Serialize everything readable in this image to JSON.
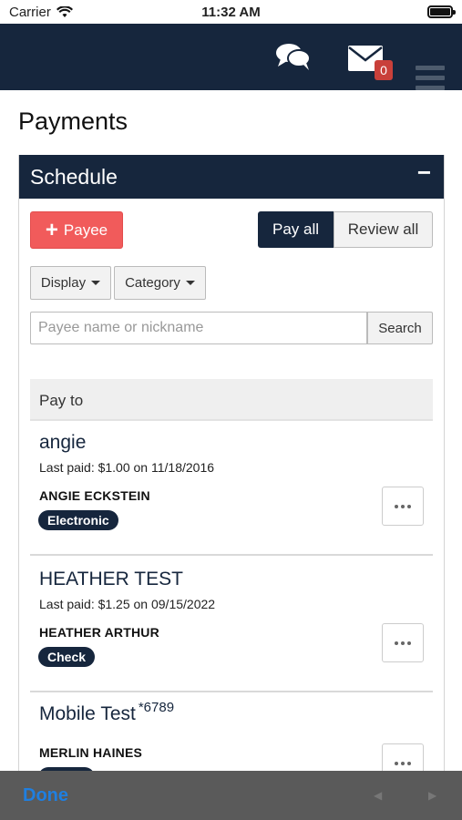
{
  "status": {
    "carrier": "Carrier",
    "time": "11:32 AM"
  },
  "header": {
    "mail_count": "0"
  },
  "page": {
    "title": "Payments"
  },
  "panel": {
    "title": "Schedule",
    "collapse_label": "−"
  },
  "toolbar": {
    "payee_plus": "+",
    "payee_label": "Payee",
    "pay_all_label": "Pay all",
    "review_all_label": "Review all",
    "display_label": "Display",
    "category_label": "Category"
  },
  "search": {
    "placeholder": "Payee name or nickname",
    "button_label": "Search"
  },
  "list": {
    "header": "Pay to",
    "payees": [
      {
        "name": "angie",
        "suffix": "",
        "last_paid": "Last paid: $1.00 on 11/18/2016",
        "owner": "ANGIE ECKSTEIN",
        "method": "Electronic"
      },
      {
        "name": "HEATHER TEST",
        "suffix": "",
        "last_paid": "Last paid: $1.25 on 09/15/2022",
        "owner": "HEATHER ARTHUR",
        "method": "Check"
      },
      {
        "name": "Mobile Test",
        "suffix": "*6789",
        "last_paid": "",
        "owner": "MERLIN HAINES",
        "method": ""
      }
    ]
  },
  "keyboard": {
    "done_label": "Done",
    "prev_arrow": "◀",
    "next_arrow": "▶"
  },
  "colors": {
    "navy": "#16263d",
    "accent_red": "#f15b5b",
    "badge_red": "#c9403a",
    "done_blue": "#1f7fe0"
  },
  "icons": [
    "wifi-icon",
    "battery-icon",
    "chat-icon",
    "mail-icon",
    "menu-icon",
    "plus-icon",
    "caret-down-icon",
    "more-icon"
  ]
}
